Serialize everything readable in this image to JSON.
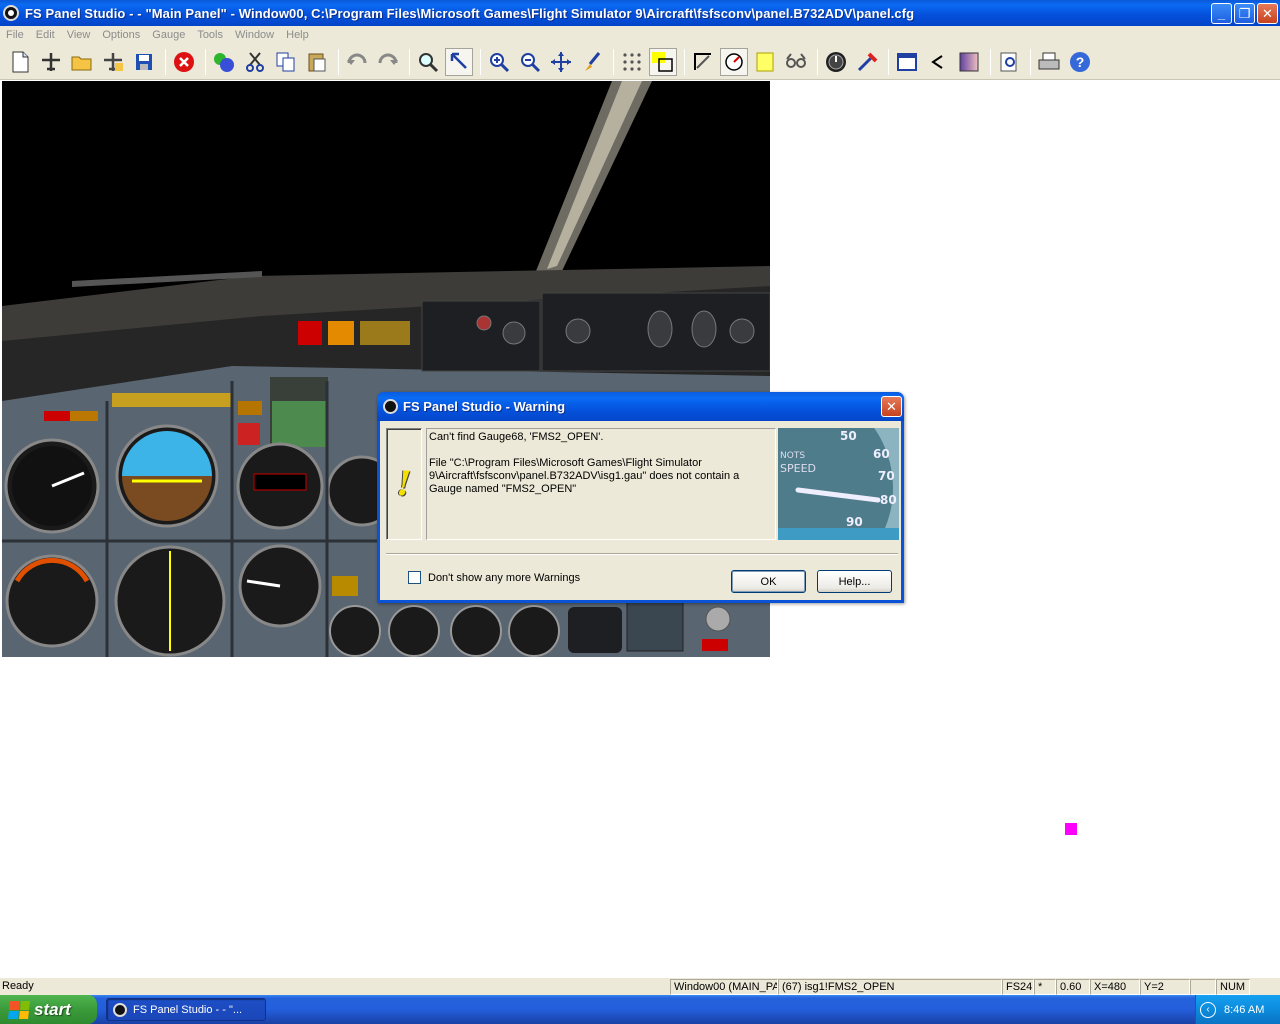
{
  "window": {
    "title": "FS Panel Studio -  - \"Main Panel\" - Window00, C:\\Program Files\\Microsoft Games\\Flight Simulator 9\\Aircraft\\fsfsconv\\panel.B732ADV\\panel.cfg",
    "minimize": "_",
    "restore": "❐",
    "close": "✕"
  },
  "menu": [
    "File",
    "Edit",
    "View",
    "Options",
    "Gauge",
    "Tools",
    "Window",
    "Help"
  ],
  "toolbar": {
    "icons": [
      "new-icon",
      "aircraft-icon",
      "open-icon",
      "aircraft-open-icon",
      "save-icon",
      "stop-icon",
      "globe-icon",
      "cut-icon",
      "copy-icon",
      "paste-icon",
      "undo-icon",
      "redo-icon",
      "magnifier-icon",
      "pointer-icon",
      "zoom-in-icon",
      "zoom-out-icon",
      "move-icon",
      "brush-icon",
      "grid-icon",
      "select-gauge-icon",
      "corner-icon",
      "gauge-edit-icon",
      "frame-icon",
      "view-icon",
      "clock-gauge-icon",
      "tools-icon",
      "window-icon",
      "back-icon",
      "gradient-icon",
      "preview-icon",
      "print-icon",
      "help-icon"
    ]
  },
  "dialog": {
    "title": "FS Panel Studio - Warning",
    "line1": "Can't find Gauge68, 'FMS2_OPEN'.",
    "line2": "File \"C:\\Program Files\\Microsoft Games\\Flight Simulator 9\\Aircraft\\fsfsconv\\panel.B732ADV\\isg1.gau\" does not contain a Gauge named \"FMS2_OPEN\"",
    "checkbox_label": "Don't show any more Warnings",
    "checkbox_checked": false,
    "ok_label": "OK",
    "help_label": "Help...",
    "speed_ticks": [
      "50",
      "60",
      "70",
      "80",
      "90"
    ],
    "speed_caption": [
      "NOTS",
      "SPEED"
    ]
  },
  "status": {
    "ready": "Ready",
    "window": "Window00 (MAIN_PA",
    "gauge": "(67) isg1!FMS2_OPEN",
    "sim": "FS24",
    "modified": "*",
    "zoom": "0.60",
    "x": "X=480",
    "y": "Y=2",
    "num": "NUM"
  },
  "taskbar": {
    "start": "start",
    "task": "FS Panel Studio -  - \"...",
    "clock": "8:46 AM"
  },
  "colors": {
    "accent": "#0a52d6",
    "marker": "#ff00ff"
  }
}
